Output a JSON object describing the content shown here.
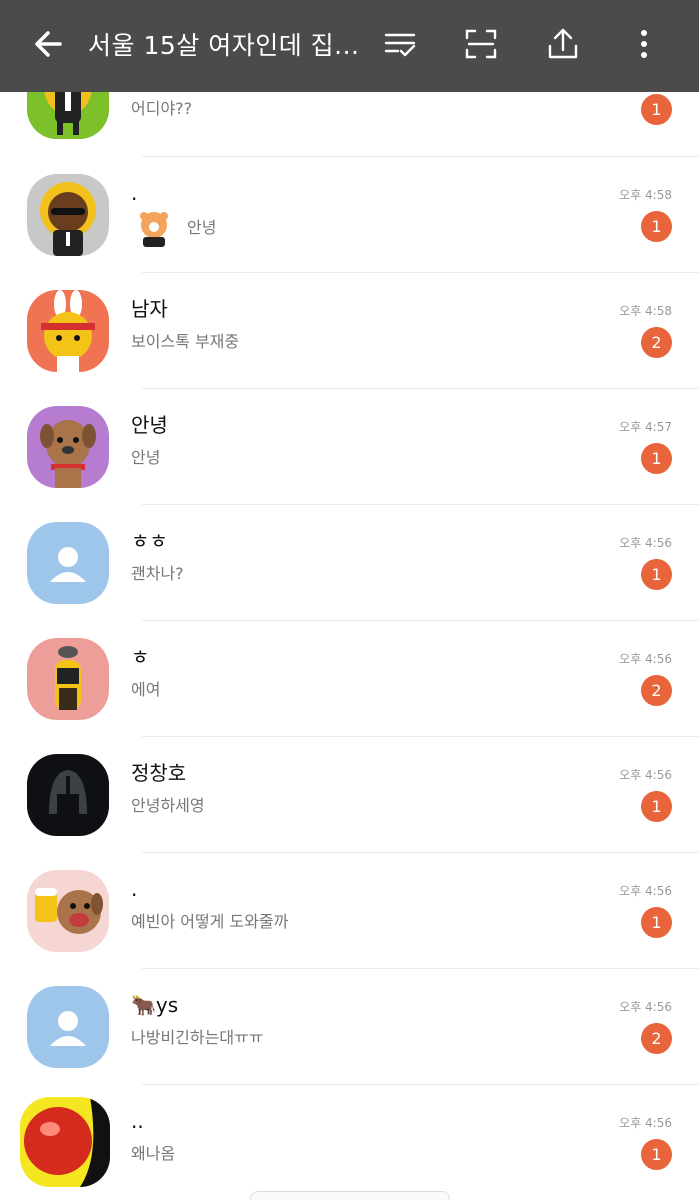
{
  "header": {
    "title": "서울 15살 여자인데 집...",
    "back_icon": "back-arrow-icon",
    "actions": [
      "checklist-icon",
      "capture-icon",
      "share-icon",
      "more-vert-icon"
    ]
  },
  "colors": {
    "header_bg": "#4b4b4b",
    "badge": "#e8643a"
  },
  "chats": [
    {
      "name": "",
      "preview": "어디야??",
      "time": "",
      "unread": "1",
      "avatar": "muzi-green"
    },
    {
      "name": ".",
      "preview": "안녕",
      "time": "오후 4:58",
      "unread": "1",
      "avatar": "frodo-grey",
      "has_sticker": true
    },
    {
      "name": "남자",
      "preview": "보이스톡 부재중",
      "time": "오후 4:58",
      "unread": "2",
      "avatar": "muzi-orange"
    },
    {
      "name": "안녕",
      "preview": "안녕",
      "time": "오후 4:57",
      "unread": "1",
      "avatar": "frodo-purple"
    },
    {
      "name": "ㅎㅎ",
      "preview": "괜차나?",
      "time": "오후 4:56",
      "unread": "1",
      "avatar": "default-blue"
    },
    {
      "name": "ㅎ",
      "preview": "에여",
      "time": "오후 4:56",
      "unread": "2",
      "avatar": "tube-pink"
    },
    {
      "name": "정창호",
      "preview": "안녕하세영",
      "time": "오후 4:56",
      "unread": "1",
      "avatar": "helmet-dark"
    },
    {
      "name": ".",
      "preview": "예빈아 어떻게 도와줄까",
      "time": "오후 4:56",
      "unread": "1",
      "avatar": "frodo-beer"
    },
    {
      "name": "🐂ys",
      "preview": "나방비긴하는대ㅠㅠ",
      "time": "오후 4:56",
      "unread": "2",
      "avatar": "default-blue"
    },
    {
      "name": "..",
      "preview": "왜나옴",
      "time": "오후 4:56",
      "unread": "1",
      "avatar": "red-ball-yellow"
    }
  ]
}
